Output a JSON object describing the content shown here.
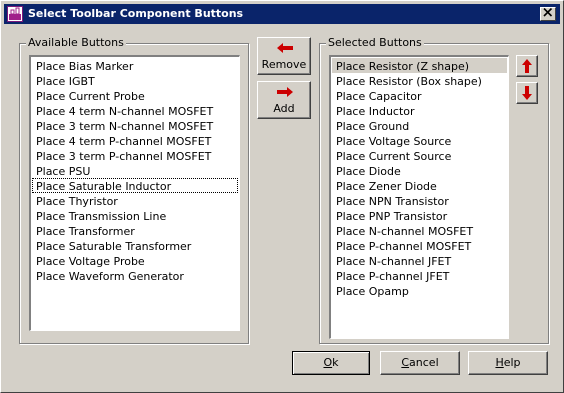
{
  "window": {
    "title": "Select Toolbar Component Buttons",
    "close_label": "X"
  },
  "available": {
    "legend": "Available Buttons",
    "items": [
      "Place Bias Marker",
      "Place IGBT",
      "Place Current Probe",
      "Place 4 term N-channel MOSFET",
      "Place 3 term N-channel MOSFET",
      "Place 4 term P-channel MOSFET",
      "Place 3 term P-channel MOSFET",
      "Place PSU",
      "Place Saturable Inductor",
      "Place Thyristor",
      "Place Transmission Line",
      "Place Transformer",
      "Place Saturable Transformer",
      "Place Voltage Probe",
      "Place Waveform Generator"
    ]
  },
  "selected": {
    "legend": "Selected Buttons",
    "items": [
      "Place Resistor (Z shape)",
      "Place Resistor (Box shape)",
      "Place Capacitor",
      "Place Inductor",
      "Place Ground",
      "Place Voltage Source",
      "Place Current Source",
      "Place Diode",
      "Place Zener Diode",
      "Place NPN Transistor",
      "Place PNP Transistor",
      "Place N-channel MOSFET",
      "Place P-channel MOSFET",
      "Place N-channel JFET",
      "Place P-channel JFET",
      "Place Opamp"
    ]
  },
  "buttons": {
    "remove": "Remove",
    "add": "Add",
    "ok_mnemonic": "O",
    "ok_rest": "k",
    "cancel_mnemonic": "C",
    "cancel_rest": "ancel",
    "help_mnemonic": "H",
    "help_rest": "elp"
  },
  "colors": {
    "titlebar": "#0a246a",
    "arrow": "#cc0000",
    "face": "#d4d0c8"
  }
}
